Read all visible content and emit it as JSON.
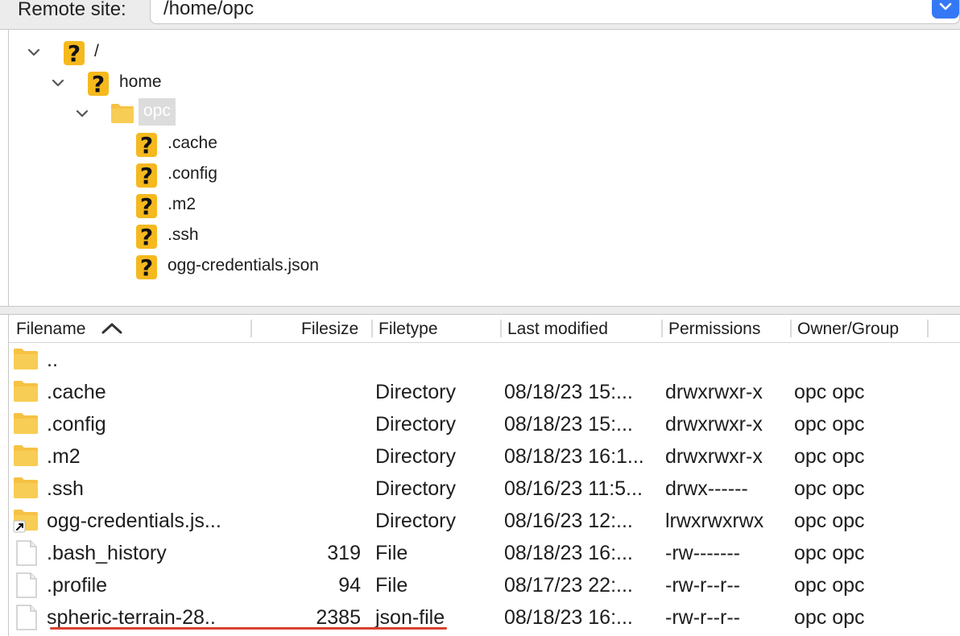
{
  "remote_site": {
    "label": "Remote site:",
    "path": "/home/opc"
  },
  "tree": {
    "root": "/",
    "home": "home",
    "opc": "opc",
    "children": [
      ".cache",
      ".config",
      ".m2",
      ".ssh",
      "ogg-credentials.json"
    ]
  },
  "columns": {
    "filename": "Filename",
    "filesize": "Filesize",
    "filetype": "Filetype",
    "last_modified": "Last modified",
    "permissions": "Permissions",
    "owner_group": "Owner/Group"
  },
  "rows": [
    {
      "name": "..",
      "size": "",
      "type": "",
      "modified": "",
      "perms": "",
      "owner": "",
      "icon": "folder-icon"
    },
    {
      "name": ".cache",
      "size": "",
      "type": "Directory",
      "modified": "08/18/23 15:...",
      "perms": "drwxrwxr-x",
      "owner": "opc opc",
      "icon": "folder-icon"
    },
    {
      "name": ".config",
      "size": "",
      "type": "Directory",
      "modified": "08/18/23 15:...",
      "perms": "drwxrwxr-x",
      "owner": "opc opc",
      "icon": "folder-icon"
    },
    {
      "name": ".m2",
      "size": "",
      "type": "Directory",
      "modified": "08/18/23 16:1...",
      "perms": "drwxrwxr-x",
      "owner": "opc opc",
      "icon": "folder-icon"
    },
    {
      "name": ".ssh",
      "size": "",
      "type": "Directory",
      "modified": "08/16/23 11:5...",
      "perms": "drwx------",
      "owner": "opc opc",
      "icon": "folder-icon"
    },
    {
      "name": "ogg-credentials.js...",
      "size": "",
      "type": "Directory",
      "modified": "08/16/23 12:...",
      "perms": "lrwxrwxrwx",
      "owner": "opc opc",
      "icon": "folder-link-icon"
    },
    {
      "name": ".bash_history",
      "size": "319",
      "type": "File",
      "modified": "08/18/23 16:...",
      "perms": "-rw-------",
      "owner": "opc opc",
      "icon": "file-icon"
    },
    {
      "name": ".profile",
      "size": "94",
      "type": "File",
      "modified": "08/17/23 22:...",
      "perms": "-rw-r--r--",
      "owner": "opc opc",
      "icon": "file-icon"
    },
    {
      "name": "spheric-terrain-28..",
      "size": "2385",
      "type": "json-file",
      "modified": "08/18/23 16:...",
      "perms": "-rw-r--r--",
      "owner": "opc opc",
      "icon": "file-icon"
    }
  ],
  "colors": {
    "accent": "#3478f6",
    "folder": "#f6c244",
    "question": "#f5b91e",
    "underline": "#d9422f"
  }
}
